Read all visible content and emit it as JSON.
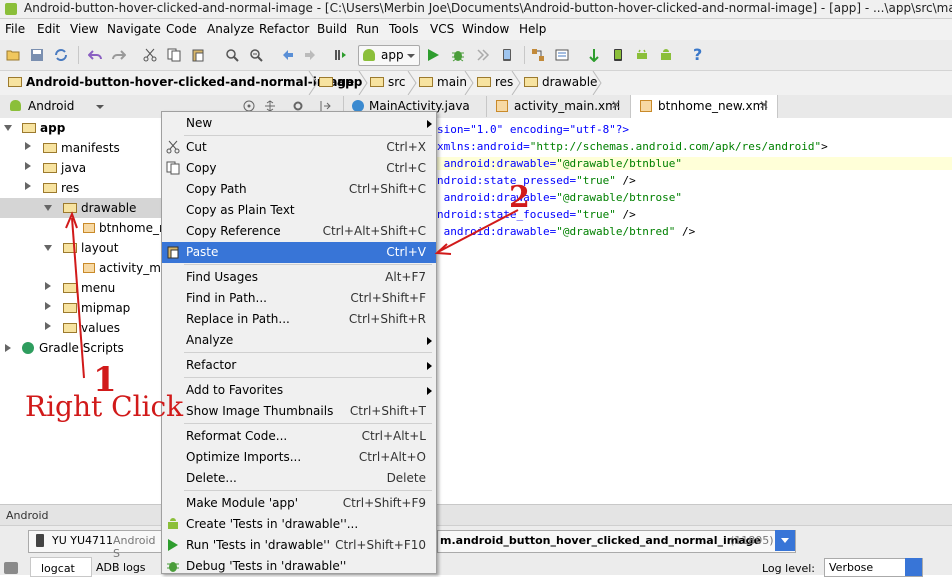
{
  "window": {
    "title": "Android-button-hover-clicked-and-normal-image - [C:\\Users\\Merbin Joe\\Documents\\Android-button-hover-clicked-and-normal-image] - [app] - ...\\app\\src\\main\\res\\drawable"
  },
  "menubar": [
    "File",
    "Edit",
    "View",
    "Navigate",
    "Code",
    "Analyze",
    "Refactor",
    "Build",
    "Run",
    "Tools",
    "VCS",
    "Window",
    "Help"
  ],
  "toolbar": {
    "run_config": "app",
    "help_label": "?"
  },
  "breadcrumb": [
    "Android-button-hover-clicked-and-normal-image",
    "app",
    "src",
    "main",
    "res",
    "drawable"
  ],
  "project": {
    "view_selector": "Android",
    "tree": {
      "app": "app",
      "manifests": "manifests",
      "java": "java",
      "res": "res",
      "drawable": "drawable",
      "btnhome": "btnhome_n",
      "layout": "layout",
      "activity": "activity_ma",
      "menu": "menu",
      "mipmap": "mipmap",
      "values": "values",
      "gradle": "Gradle Scripts"
    }
  },
  "tabs": [
    {
      "label": "MainActivity.java"
    },
    {
      "label": "activity_main.xml"
    },
    {
      "label": "btnhome_new.xml"
    }
  ],
  "editor": {
    "line1a": "sion=\"1.0\" encoding=\"utf-8\"?>",
    "line2a": "xmlns:android=",
    "line2b": "\"http://schemas.android.com/apk/res/android\"",
    "line2c": ">",
    "line3a": " android:drawable=",
    "line3b": "\"@drawable/btnblue\"",
    "line4a": "ndroid:state_pressed=",
    "line4b": "\"true\"",
    "line4c": " />",
    "line5a": " android:drawable=",
    "line5b": "\"@drawable/btnrose\"",
    "line6a": "ndroid:state_focused=",
    "line6b": "\"true\"",
    "line6c": " />",
    "line7a": " android:drawable=",
    "line7b": "\"@drawable/btnred\"",
    "line7c": " />"
  },
  "context_menu": [
    {
      "label": "New",
      "shortcut": "",
      "submenu": true
    },
    {
      "label": "Cut",
      "shortcut": "Ctrl+X"
    },
    {
      "label": "Copy",
      "shortcut": "Ctrl+C"
    },
    {
      "label": "Copy Path",
      "shortcut": "Ctrl+Shift+C"
    },
    {
      "label": "Copy as Plain Text",
      "shortcut": ""
    },
    {
      "label": "Copy Reference",
      "shortcut": "Ctrl+Alt+Shift+C"
    },
    {
      "label": "Paste",
      "shortcut": "Ctrl+V",
      "selected": true
    },
    {
      "label": "Find Usages",
      "shortcut": "Alt+F7"
    },
    {
      "label": "Find in Path...",
      "shortcut": "Ctrl+Shift+F"
    },
    {
      "label": "Replace in Path...",
      "shortcut": "Ctrl+Shift+R"
    },
    {
      "label": "Analyze",
      "shortcut": "",
      "submenu": true
    },
    {
      "label": "Refactor",
      "shortcut": "",
      "submenu": true
    },
    {
      "label": "Add to Favorites",
      "shortcut": "",
      "submenu": true
    },
    {
      "label": "Show Image Thumbnails",
      "shortcut": "Ctrl+Shift+T"
    },
    {
      "label": "Reformat Code...",
      "shortcut": "Ctrl+Alt+L"
    },
    {
      "label": "Optimize Imports...",
      "shortcut": "Ctrl+Alt+O"
    },
    {
      "label": "Delete...",
      "shortcut": "Delete"
    },
    {
      "label": "Make Module 'app'",
      "shortcut": "Ctrl+Shift+F9"
    },
    {
      "label": "Create 'Tests in 'drawable''...",
      "shortcut": ""
    },
    {
      "label": "Run 'Tests in 'drawable''",
      "shortcut": "Ctrl+Shift+F10"
    },
    {
      "label": "Debug 'Tests in 'drawable''",
      "shortcut": ""
    }
  ],
  "bottom": {
    "panel_title": "Android",
    "device": "YU YU4711",
    "device_suffix": "Android S",
    "process": "m.android_button_hover_clicked_and_normal_image",
    "pid": "(11805)",
    "tab1": "logcat",
    "tab2": "ADB logs",
    "log_level_label": "Log level:",
    "log_level": "Verbose"
  },
  "annotations": {
    "n1": "1",
    "right_click": "Right Click",
    "n2": "2"
  },
  "colors": {
    "selection": "#3875d7",
    "annotation": "#d11a1a",
    "green": "#2e9d2e"
  }
}
